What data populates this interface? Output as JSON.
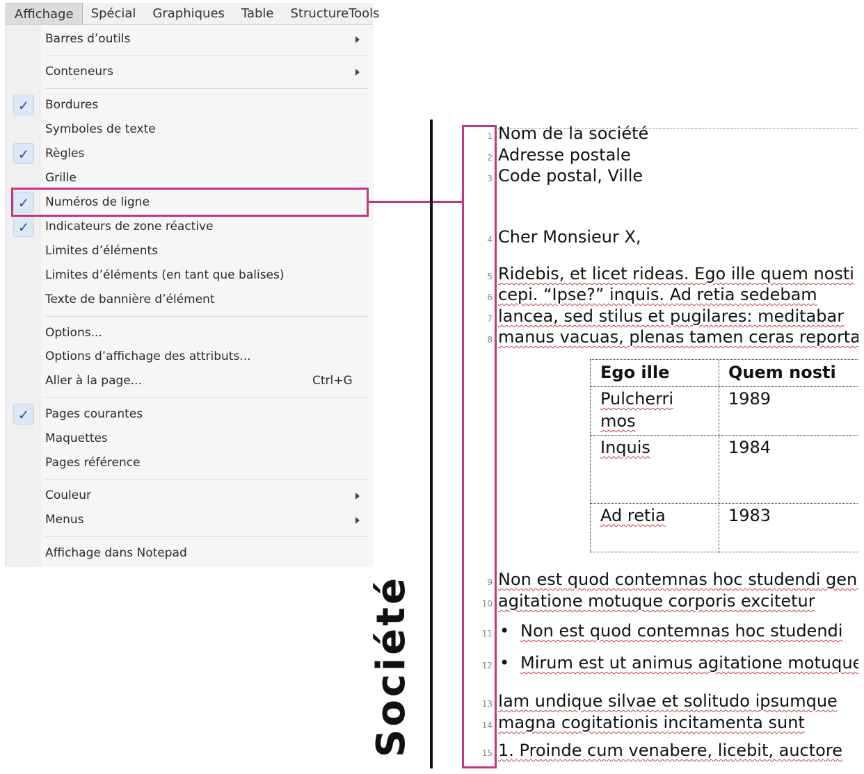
{
  "menubar": {
    "tabs": [
      "Affichage",
      "Spécial",
      "Graphiques",
      "Table",
      "StructureTools"
    ],
    "active_index": 0
  },
  "menu": {
    "items": [
      {
        "label": "Barres d’outils",
        "checked": false,
        "submenu": true
      },
      {
        "label": "Conteneurs",
        "checked": false,
        "submenu": true
      },
      {
        "label": "Bordures",
        "checked": true
      },
      {
        "label": "Symboles de texte",
        "checked": false
      },
      {
        "label": "Règles",
        "checked": true
      },
      {
        "label": "Grille",
        "checked": false
      },
      {
        "label": "Numéros de ligne",
        "checked": true,
        "highlighted": true
      },
      {
        "label": "Indicateurs de zone réactive",
        "checked": true
      },
      {
        "label": "Limites d’éléments",
        "checked": false
      },
      {
        "label": "Limites d’éléments (en tant que balises)",
        "checked": false
      },
      {
        "label": "Texte de bannière d’élément",
        "checked": false
      },
      {
        "label": "Options...",
        "checked": false
      },
      {
        "label": "Options d’affichage des attributs...",
        "checked": false
      },
      {
        "label": "Aller à la page...",
        "checked": false,
        "shortcut": "Ctrl+G"
      },
      {
        "label": "Pages courantes",
        "checked": true
      },
      {
        "label": "Maquettes",
        "checked": false
      },
      {
        "label": "Pages référence",
        "checked": false
      },
      {
        "label": "Couleur",
        "checked": false,
        "submenu": true
      },
      {
        "label": "Menus",
        "checked": false,
        "submenu": true
      },
      {
        "label": "Affichage dans Notepad",
        "checked": false
      }
    ],
    "check_glyph": "✓",
    "highlight_color": "#c2377f"
  },
  "side_label": "Société",
  "doc": {
    "header_lines": [
      "Nom de la société",
      "Adresse postale",
      "Code postal, Ville"
    ],
    "salutation": "Cher Monsieur X,",
    "paragraph1": [
      "Ridebis, et licet rideas. Ego ille quem nosti",
      "cepi. “Ipse?” inquis. Ad retia sedebam",
      "lancea, sed stilus et pugilares: meditabar",
      "manus vacuas, plenas tamen ceras reportarem"
    ],
    "table": {
      "headers": [
        "Ego ille",
        "Quem nosti"
      ],
      "rows": [
        [
          "Pulcherri",
          "mos",
          "1989"
        ],
        [
          "Inquis",
          "",
          "1984"
        ],
        [
          "Ad retia",
          "",
          "1983"
        ]
      ]
    },
    "paragraph2": [
      "Non est quod contemnas hoc studendi genus",
      "agitatione motuque corporis excitetur"
    ],
    "bullets": [
      "Non est quod contemnas hoc studendi",
      "Mirum est ut animus agitatione motuque"
    ],
    "paragraph3": [
      "Iam undique silvae et solitudo ipsumque",
      "magna cogitationis incitamenta sunt"
    ],
    "numbered": [
      "1. Proinde cum venabere, licebit, auctore"
    ],
    "line_numbers": [
      "1",
      "2",
      "3",
      "4",
      "5",
      "6",
      "7",
      "8",
      "9",
      "10",
      "11",
      "12",
      "13",
      "14",
      "15"
    ]
  }
}
